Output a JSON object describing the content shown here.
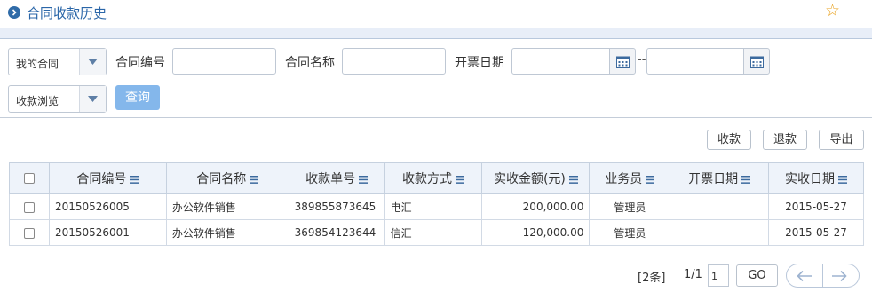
{
  "header": {
    "title": "合同收款历史"
  },
  "filters": {
    "scope_select": "我的合同",
    "view_select": "收款浏览",
    "contract_no_label": "合同编号",
    "contract_name_label": "合同名称",
    "invoice_date_label": "开票日期",
    "range_sep": "--",
    "query_button": "查询"
  },
  "toolbar": {
    "collect": "收款",
    "refund": "退款",
    "export": "导出"
  },
  "table": {
    "columns": [
      "合同编号",
      "合同名称",
      "收款单号",
      "收款方式",
      "实收金额(元)",
      "业务员",
      "开票日期",
      "实收日期"
    ],
    "rows": [
      [
        "20150526005",
        "办公软件销售",
        "389855873645",
        "电汇",
        "200,000.00",
        "管理员",
        "",
        "2015-05-27"
      ],
      [
        "20150526001",
        "办公软件销售",
        "369854123644",
        "信汇",
        "120,000.00",
        "管理员",
        "",
        "2015-05-27"
      ]
    ]
  },
  "pager": {
    "count": "[2条]",
    "page": "1/1",
    "page_input": "1",
    "go": "GO"
  },
  "colors": {
    "accent": "#2a66a8",
    "query_button": "#84b7eb",
    "star": "#e9a21f"
  }
}
